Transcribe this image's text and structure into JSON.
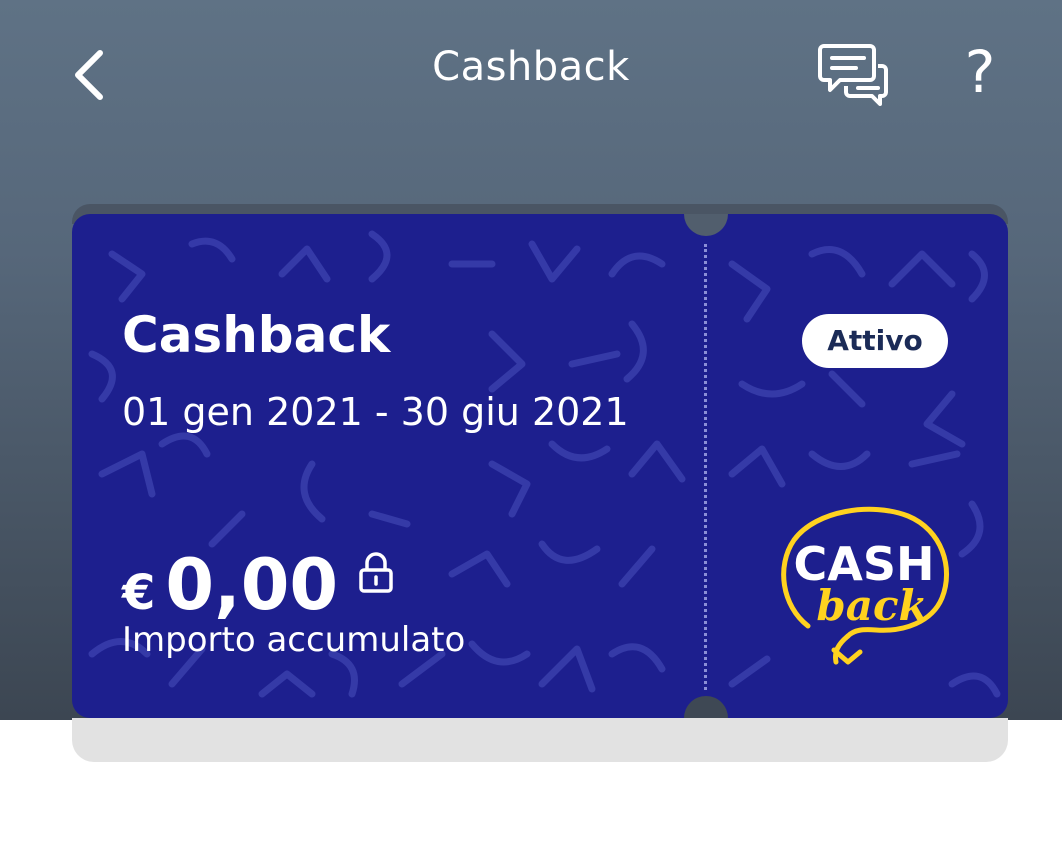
{
  "header": {
    "title": "Cashback",
    "back_icon": "chevron-left-icon",
    "chat_icon": "chat-bubbles-icon",
    "help_label": "?"
  },
  "card": {
    "title": "Cashback",
    "period": "01 gen 2021 - 30 giu 2021",
    "status": "Attivo",
    "currency": "€",
    "amount": "0,00",
    "amount_label": "Importo accumulato",
    "lock_icon": "lock-icon",
    "logo_word_top": "CASH",
    "logo_word_bottom": "back"
  },
  "colors": {
    "card_background": "#1d1f8e",
    "header_gradient_top": "#5f7285",
    "header_gradient_bottom": "#3c4652",
    "badge_text": "#1b2b57",
    "logo_accent": "#ffd21f"
  }
}
